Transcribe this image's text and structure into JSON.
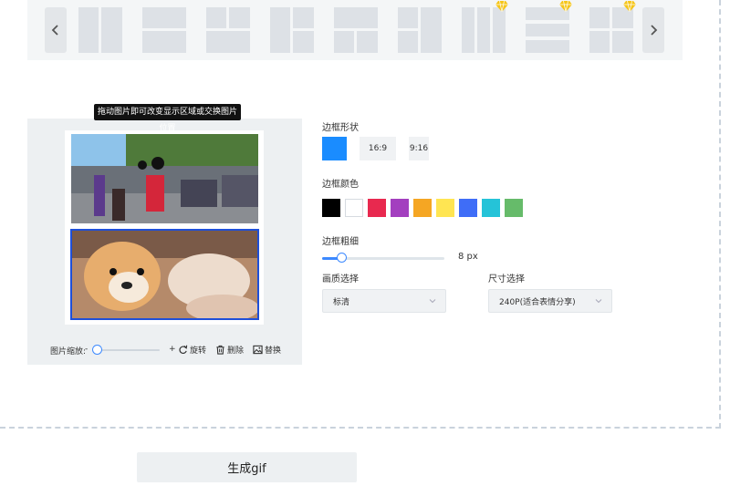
{
  "layouts": {
    "prev_icon": "chevron-left-icon",
    "next_icon": "chevron-right-icon",
    "premium_icon": "diamond-icon",
    "premium_color": "#f5c518"
  },
  "editor": {
    "tooltip": "拖动图片即可改变显示区域或交换图片位置",
    "zoom_label": "图片缩放:",
    "zoom_minus": "-",
    "zoom_plus": "+",
    "rotate_label": "旋转",
    "delete_label": "删除",
    "replace_label": "替换",
    "selected_border_color": "#1f4fd8"
  },
  "settings": {
    "shape_label": "边框形状",
    "shape_options": [
      "16:9",
      "9:16"
    ],
    "shape_selected_color": "#1a8cff",
    "color_label": "边框颜色",
    "colors": [
      "#000000",
      "#ffffff",
      "#e8294f",
      "#a33fbf",
      "#f5a623",
      "#ffe552",
      "#3f6df7",
      "#25c3d8",
      "#66bb6a"
    ],
    "thickness_label": "边框粗细",
    "thickness_value": "8 px",
    "quality_label": "画质选择",
    "quality_value": "标清",
    "size_label": "尺寸选择",
    "size_value": "240P(适合表情分享)"
  },
  "generate_button": "生成gif"
}
